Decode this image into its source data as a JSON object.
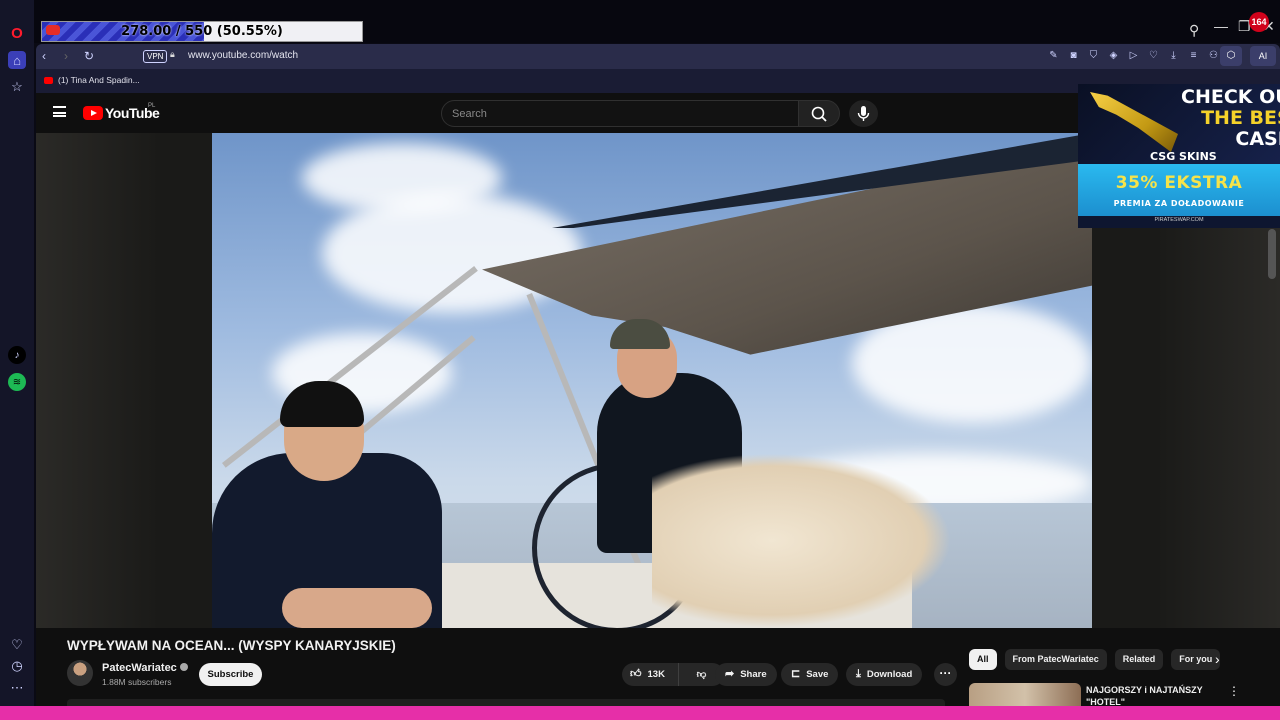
{
  "stream": {
    "goal_text": "278.00 / 550 (50.55%)",
    "progress": 0.5055
  },
  "notification_count": "164",
  "browser": {
    "url": "www.youtube.com/watch",
    "vpn_label": "VPN",
    "ai_label": "AI",
    "bookmark": "(1) Tina And Spadin..."
  },
  "youtube": {
    "logo": "YouTube",
    "region": "PL",
    "search_placeholder": "Search",
    "video": {
      "title": "WYPŁYWAM NA OCEAN... (WYSPY KANARYJSKIE)",
      "channel": "PatecWariatec",
      "subscribers": "1.88M subscribers",
      "subscribe_label": "Subscribe",
      "likes": "13K",
      "share_label": "Share",
      "save_label": "Save",
      "download_label": "Download"
    },
    "chips": [
      "All",
      "From PatecWariatec",
      "Related",
      "For you"
    ],
    "recommendation_title": "NAJGORSZY i NAJTAŃSZY \"HOTEL\""
  },
  "ad": {
    "line1": "CHECK OU",
    "line2": "THE BES",
    "line3": "CASE",
    "brand": "CSG SKINS",
    "promo": "35% EKSTRA",
    "promo_sub": "PREMIA ZA DOŁADOWANIE",
    "footer": "PIRATESWAP.COM"
  },
  "colors": {
    "youtube_red": "#ff0000",
    "opera_red": "#ff1b2d",
    "stream_bar": "#e62fa8"
  },
  "icons": [
    "opera-icon",
    "home-icon",
    "star-icon",
    "tiktok-icon",
    "spotify-icon",
    "heart-icon",
    "history-icon",
    "more-icon",
    "search-icon",
    "mic-icon"
  ]
}
